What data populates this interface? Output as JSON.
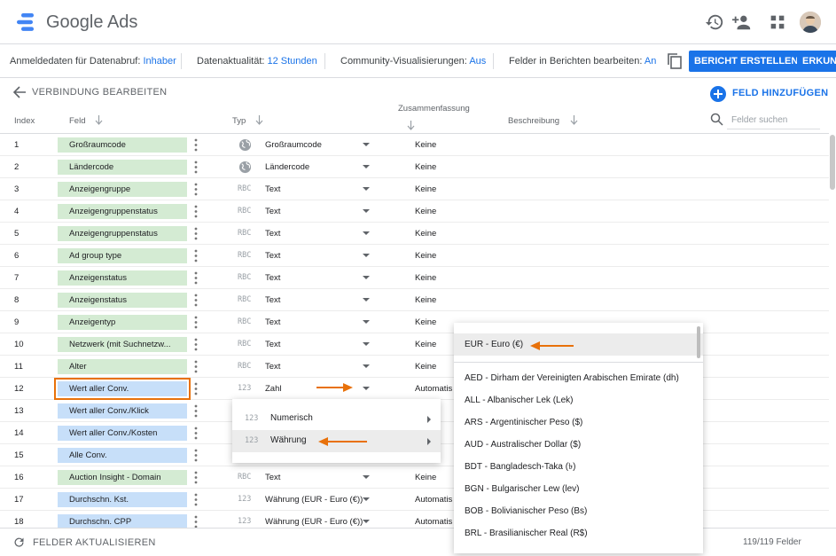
{
  "app": {
    "title": "Google Ads"
  },
  "infobar": {
    "credentials_label": "Anmeldedaten für Datenabruf:",
    "credentials_value": "Inhaber",
    "freshness_label": "Datenaktualität:",
    "freshness_value": "12 Stunden",
    "community_label": "Community-Visualisierungen:",
    "community_value": "Aus",
    "edit_label": "Felder in Berichten bearbeiten:",
    "edit_value": "An",
    "create_report": "BERICHT ERSTELLEN",
    "explore": "ERKUND"
  },
  "header": {
    "title": "VERBINDUNG BEARBEITEN",
    "add_field": "FELD HINZUFÜGEN"
  },
  "columns": {
    "index": "Index",
    "field": "Feld",
    "type": "Typ",
    "aggregation": "Zusammenfassung",
    "description": "Beschreibung",
    "search_placeholder": "Felder suchen"
  },
  "rows": [
    {
      "index": "1",
      "field": "Großraumcode",
      "color": "green",
      "type_icon": "globe",
      "type": "Großraumcode",
      "agg": "Keine"
    },
    {
      "index": "2",
      "field": "Ländercode",
      "color": "green",
      "type_icon": "globe",
      "type": "Ländercode",
      "agg": "Keine"
    },
    {
      "index": "3",
      "field": "Anzeigengruppe",
      "color": "green",
      "type_icon": "RBC",
      "type": "Text",
      "agg": "Keine"
    },
    {
      "index": "4",
      "field": "Anzeigengruppenstatus",
      "color": "green",
      "type_icon": "RBC",
      "type": "Text",
      "agg": "Keine"
    },
    {
      "index": "5",
      "field": "Anzeigengruppenstatus",
      "color": "green",
      "type_icon": "RBC",
      "type": "Text",
      "agg": "Keine"
    },
    {
      "index": "6",
      "field": "Ad group type",
      "color": "green",
      "type_icon": "RBC",
      "type": "Text",
      "agg": "Keine"
    },
    {
      "index": "7",
      "field": "Anzeigenstatus",
      "color": "green",
      "type_icon": "RBC",
      "type": "Text",
      "agg": "Keine"
    },
    {
      "index": "8",
      "field": "Anzeigenstatus",
      "color": "green",
      "type_icon": "RBC",
      "type": "Text",
      "agg": "Keine"
    },
    {
      "index": "9",
      "field": "Anzeigentyp",
      "color": "green",
      "type_icon": "RBC",
      "type": "Text",
      "agg": "Keine"
    },
    {
      "index": "10",
      "field": "Netzwerk (mit Suchnetzw...",
      "color": "green",
      "type_icon": "RBC",
      "type": "Text",
      "agg": "Keine"
    },
    {
      "index": "11",
      "field": "Alter",
      "color": "green",
      "type_icon": "RBC",
      "type": "Text",
      "agg": "Keine"
    },
    {
      "index": "12",
      "field": "Wert aller Conv.",
      "color": "blue",
      "type_icon": "123",
      "type": "Zahl",
      "agg": "Automatis",
      "selected": true
    },
    {
      "index": "13",
      "field": "Wert aller Conv./Klick",
      "color": "blue",
      "type_icon": "",
      "type": "",
      "agg": ""
    },
    {
      "index": "14",
      "field": "Wert aller Conv./Kosten",
      "color": "blue",
      "type_icon": "",
      "type": "",
      "agg": ""
    },
    {
      "index": "15",
      "field": "Alle Conv.",
      "color": "blue",
      "type_icon": "",
      "type": "",
      "agg": ""
    },
    {
      "index": "16",
      "field": "Auction Insight - Domain",
      "color": "green",
      "type_icon": "RBC",
      "type": "Text",
      "agg": "Keine"
    },
    {
      "index": "17",
      "field": "Durchschn. Kst.",
      "color": "blue",
      "type_icon": "123",
      "type": "Währung (EUR - Euro (€))",
      "agg": "Automatis"
    },
    {
      "index": "18",
      "field": "Durchschn. CPP",
      "color": "blue",
      "type_icon": "123",
      "type": "Währung (EUR - Euro (€))",
      "agg": "Automatis"
    }
  ],
  "type_menu": [
    {
      "icon": "123",
      "label": "Numerisch"
    },
    {
      "icon": "123",
      "label": "Währung",
      "highlighted": true
    }
  ],
  "currency_menu": {
    "selected": "EUR - Euro (€)",
    "items": [
      "AED - Dirham der Vereinigten Arabischen Emirate (dh)",
      "ALL - Albanischer Lek (Lek)",
      "ARS - Argentinischer Peso ($)",
      "AUD - Australischer Dollar ($)",
      "BDT - Bangladesch-Taka (৳)",
      "BGN - Bulgarischer Lew (lev)",
      "BOB - Bolivianischer Peso (Bs)",
      "BRL - Brasilianischer Real (R$)"
    ]
  },
  "footer": {
    "refresh": "FELDER AKTUALISIEREN",
    "count": "119/119 Felder"
  },
  "colors": {
    "accent": "#1a73e8",
    "dimension_chip": "#d4ebd3",
    "metric_chip": "#c7dff9",
    "annotation_arrow": "#e8710a"
  }
}
